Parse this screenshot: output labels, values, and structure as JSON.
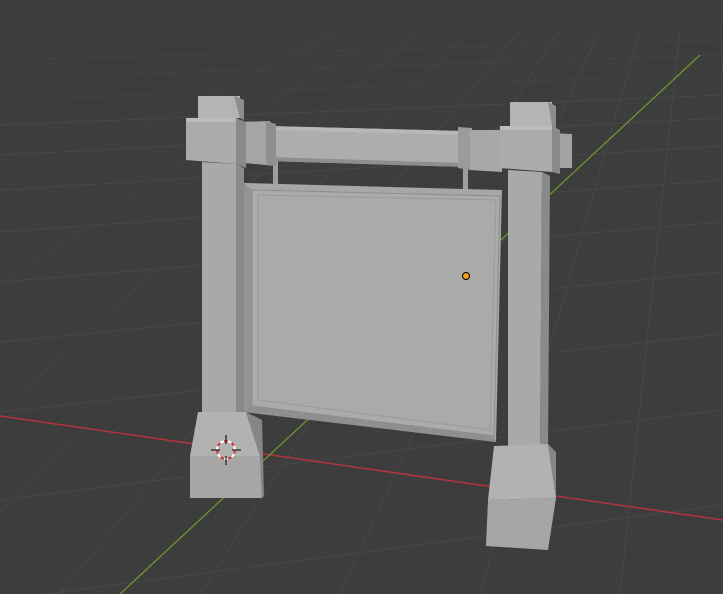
{
  "app": {
    "name": "3D viewport"
  },
  "viewport": {
    "background_color": "#3d3d3d",
    "grid_color": "#474747",
    "x_axis_color": "#b3343c",
    "y_axis_color": "#6c9c2c",
    "object_color": "#a9a9a9",
    "origin_color": "#f0a020",
    "cursor_colors": [
      "#d23b3b",
      "#ffffff"
    ]
  },
  "scene": {
    "object": "signboard-mesh",
    "parts": [
      "left-post",
      "right-post",
      "crossbeam",
      "sign-panel",
      "left-base",
      "right-base",
      "hanging-rods"
    ],
    "selection": "none",
    "origin_marker": "object-origin-dot",
    "cursor": "3d-cursor"
  }
}
